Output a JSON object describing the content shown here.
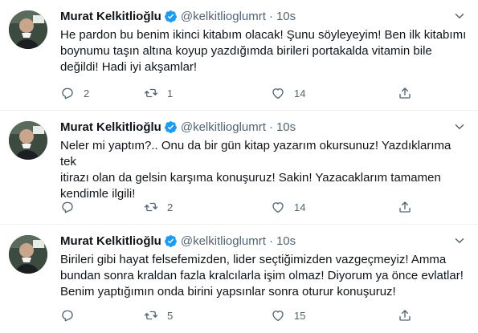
{
  "tweets": [
    {
      "author": "Murat Kelkitlioğlu",
      "handle": "@kelkitlioglumrt",
      "separator": "·",
      "time": "10s",
      "text": "He pardon bu benim ikinci kitabım olacak! Şunu söyleyeyim! Ben ilk kitabımı\nboynumu taşın altına koyup yazdığımda birileri portakalda vitamin bile\ndeğildi! Hadi iyi akşamlar!",
      "replies": "2",
      "retweets": "1",
      "likes": "14"
    },
    {
      "author": "Murat Kelkitlioğlu",
      "handle": "@kelkitlioglumrt",
      "separator": "·",
      "time": "10s",
      "text": "Neler mi yaptım?.. Onu da bir gün kitap yazarım okursunuz! Yazdıklarıma tek\nitirazı olan da gelsin karşıma konuşuruz! Sakin! Yazacaklarım tamamen\nkendimle ilgili!",
      "replies": "",
      "retweets": "2",
      "likes": "14"
    },
    {
      "author": "Murat Kelkitlioğlu",
      "handle": "@kelkitlioglumrt",
      "separator": "·",
      "time": "10s",
      "text": "Birileri gibi hayat felsefemizden, lider seçtiğimizden vazgeçmeyiz! Amma\nbundan sonra kraldan fazla kralcılarla işim olmaz! Diyorum ya önce evlatlar!\nBenim yaptığımın onda birini yapsınlar sonra oturur konuşuruz!",
      "replies": "",
      "retweets": "5",
      "likes": "15"
    }
  ],
  "colors": {
    "text": "#0f1419",
    "secondary": "#536471",
    "verified": "#1d9bf0",
    "divider": "#eff3f4"
  },
  "icons": [
    "avatar",
    "verified-badge-icon",
    "more-caret-icon",
    "reply-icon",
    "retweet-icon",
    "like-icon",
    "share-icon"
  ]
}
